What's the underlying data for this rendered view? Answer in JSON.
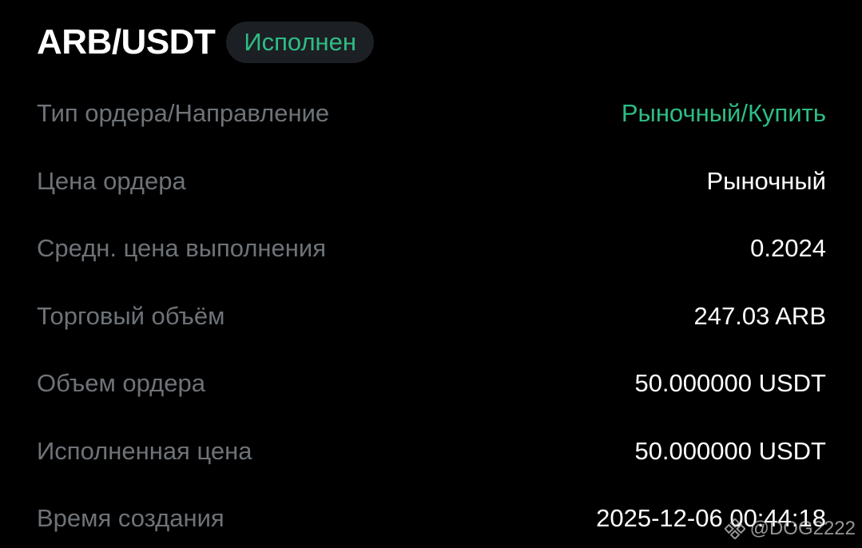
{
  "header": {
    "pair": "ARB/USDT",
    "status": "Исполнен"
  },
  "rows": [
    {
      "label": "Тип ордера/Направление",
      "value": "Рыночный/Купить"
    },
    {
      "label": "Цена ордера",
      "value": "Рыночный"
    },
    {
      "label": "Средн. цена выполнения",
      "value": "0.2024"
    },
    {
      "label": "Торговый объём",
      "value": "247.03 ARB"
    },
    {
      "label": "Объем ордера",
      "value": "50.000000 USDT"
    },
    {
      "label": "Исполненная цена",
      "value": "50.000000 USDT"
    },
    {
      "label": "Время создания",
      "value": "2025-12-06 00:44:18"
    }
  ],
  "watermark": {
    "icon": "binance-logo-icon",
    "text": "@DOG2222"
  },
  "colors": {
    "background": "#000000",
    "accent_green": "#2ebd85",
    "label_gray": "#6e7378",
    "badge_bg": "#1c1f23"
  }
}
